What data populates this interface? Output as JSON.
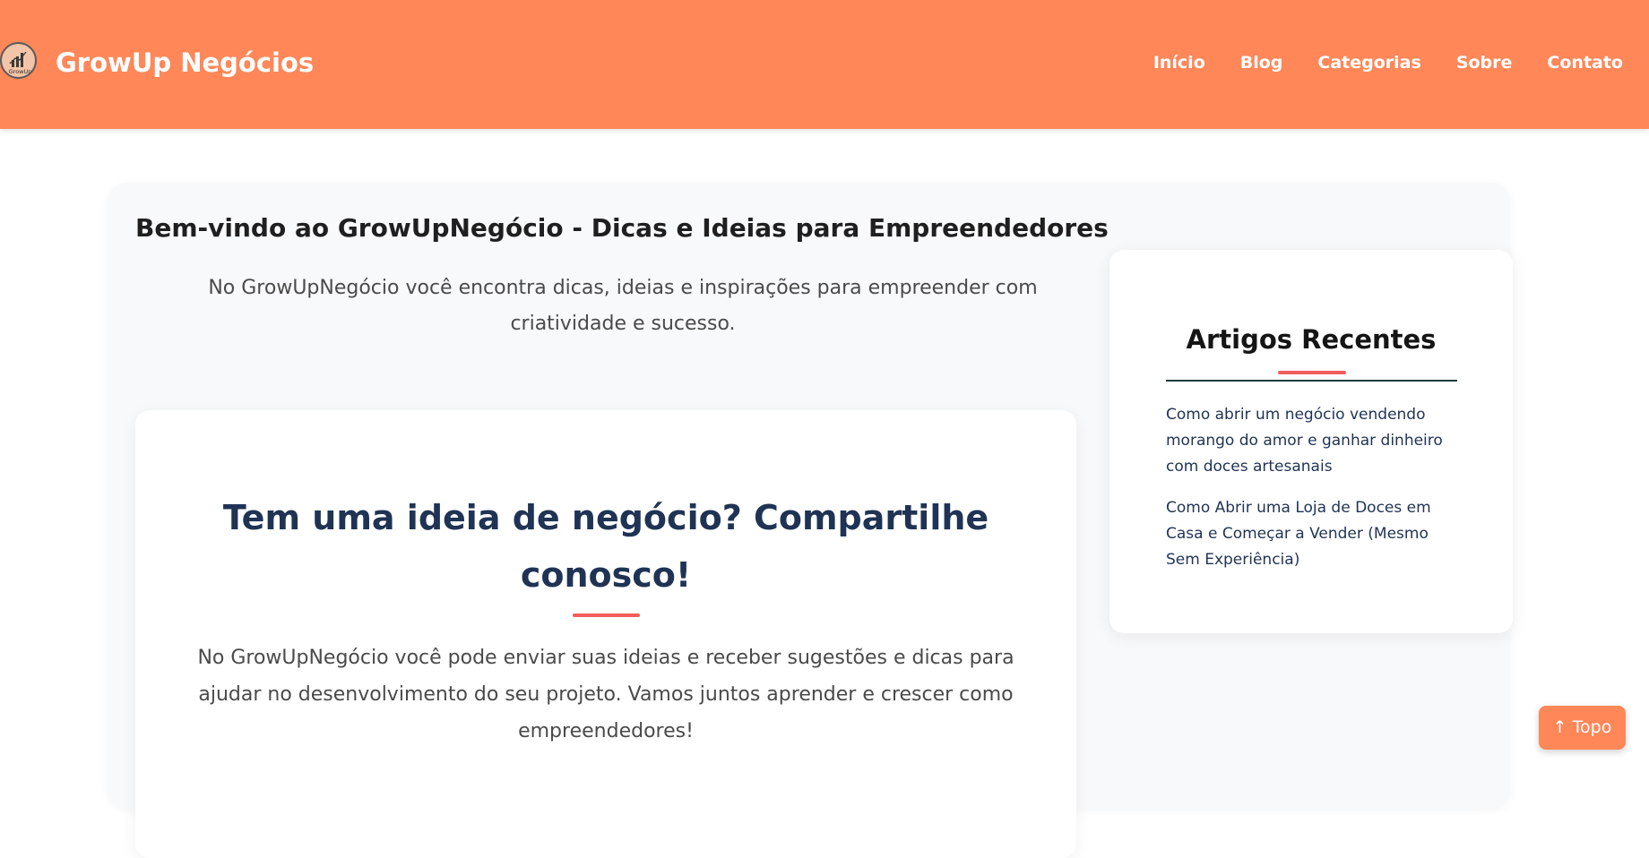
{
  "header": {
    "brand": "GrowUp Negócios",
    "logo_text": "GrowUp",
    "nav": [
      "Início",
      "Blog",
      "Categorias",
      "Sobre",
      "Contato"
    ]
  },
  "welcome": {
    "title": "Bem-vindo ao GrowUpNegócio - Dicas e Ideias para Empreendedores",
    "text": "No GrowUpNegócio você encontra dicas, ideias e inspirações para empreender com criatividade e sucesso."
  },
  "cta": {
    "title": "Tem uma ideia de negócio? Compartilhe conosco!",
    "text": "No GrowUpNegócio você pode enviar suas ideias e receber sugestões e dicas para ajudar no desenvolvimento do seu projeto. Vamos juntos aprender e crescer como empreendedores!"
  },
  "sidebar": {
    "title": "Artigos Recentes",
    "articles": [
      "Como abrir um negócio vendendo morango do amor e ganhar dinheiro com doces artesanais",
      "Como Abrir uma Loja de Doces em Casa e Começar a Vender (Mesmo Sem Experiência)"
    ]
  },
  "top_button": {
    "label": "↑ Topo"
  },
  "colors": {
    "header_bg": "#ff8758",
    "accent": "#f25c5c",
    "heading_navy": "#1f3354",
    "panel_bg": "#f8f9fa"
  }
}
